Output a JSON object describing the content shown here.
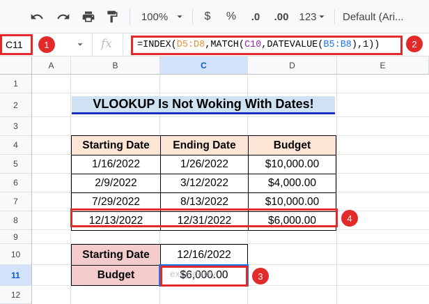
{
  "toolbar": {
    "zoom": "100%",
    "currency_symbol": "$",
    "percent_symbol": "%",
    "decrease_decimal": ".0",
    "increase_decimal": ".00",
    "number_format": "123",
    "font": "Default (Ari..."
  },
  "formula_bar": {
    "cell_ref": "C11",
    "fx": "fx",
    "formula_parts": {
      "p1": "=INDEX(",
      "r1": "D5:D8",
      "p2": ",MATCH(",
      "r2": "C10",
      "p3": ",DATEVALUE(",
      "r3": "B5:B8",
      "p4": "),1))"
    }
  },
  "columns": [
    "A",
    "B",
    "C",
    "D",
    "E"
  ],
  "rows": [
    "1",
    "2",
    "3",
    "4",
    "5",
    "6",
    "7",
    "8",
    "9",
    "10",
    "11",
    "12"
  ],
  "sheet": {
    "title": "VLOOKUP Is Not Woking With Dates!",
    "headers": [
      "Starting Date",
      "Ending Date",
      "Budget"
    ],
    "data": [
      [
        "1/16/2022",
        "1/26/2022",
        "$10,000.00"
      ],
      [
        "2/9/2022",
        "3/12/2022",
        "$4,000.00"
      ],
      [
        "7/29/2022",
        "8/13/2022",
        "$10,000.00"
      ],
      [
        "12/13/2022",
        "12/31/2022",
        "$6,000.00"
      ]
    ],
    "lookup_label": "Starting Date",
    "lookup_value": "12/16/2022",
    "result_label": "Budget",
    "result_value": "$6,000.00"
  },
  "badges": [
    "1",
    "2",
    "3",
    "4"
  ],
  "colors": {
    "highlight": "#e22a2a",
    "header_fill": "#fce5d5",
    "label_fill": "#f4cccc",
    "title_fill": "#cfe2f3",
    "range_orange": "#e69138",
    "range_purple": "#9c27b0",
    "range_blue": "#1a73e8"
  },
  "watermark": "exceldemy"
}
